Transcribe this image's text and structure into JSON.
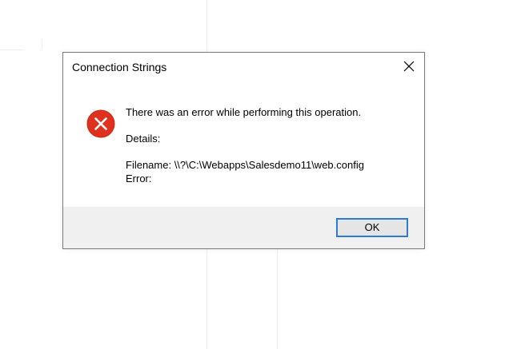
{
  "dialog": {
    "title": "Connection Strings",
    "icon": "error-icon",
    "message": "There was an error while performing this operation.",
    "details_label": "Details:",
    "filename_line": "Filename: \\\\?\\C:\\Webapps\\Salesdemo11\\web.config",
    "error_line": "Error:",
    "ok_label": "OK",
    "close_icon": "close-icon"
  },
  "colors": {
    "error_red": "#e0301e",
    "ok_border": "#2f7ad6",
    "footer_bg": "#f0f0f0"
  }
}
